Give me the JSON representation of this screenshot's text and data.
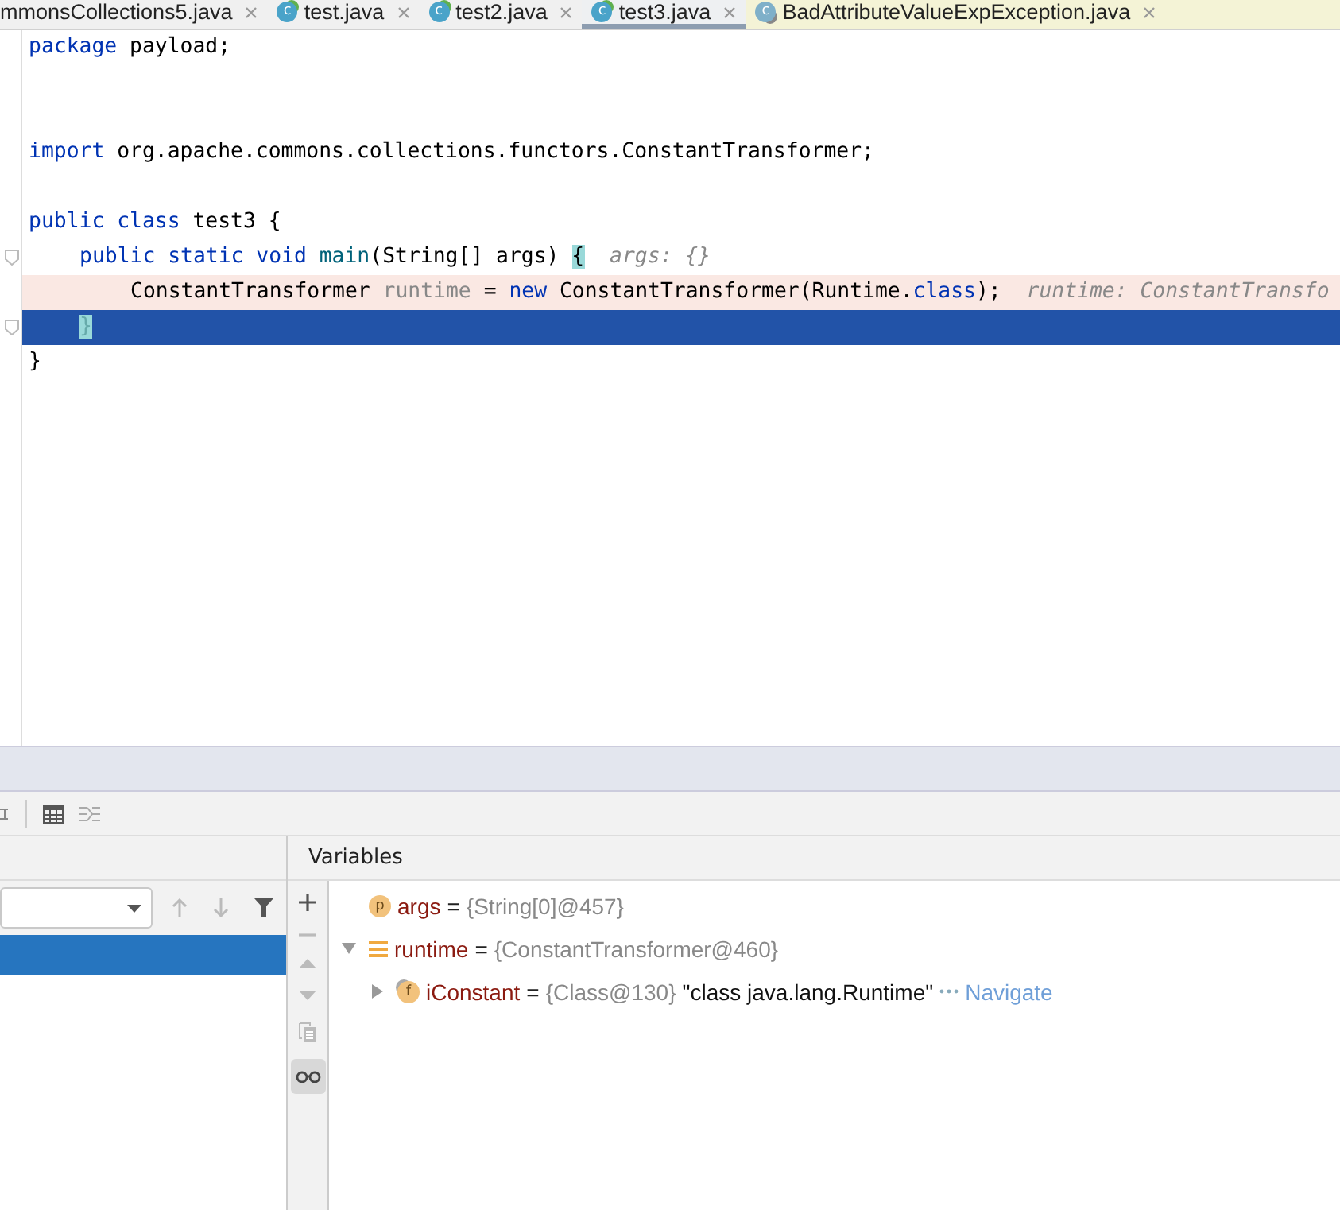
{
  "tabs": [
    {
      "label": "mmonsCollections5.java",
      "kind": "partial",
      "selected": false
    },
    {
      "label": "test.java",
      "kind": "class",
      "badge": "c",
      "selected": false
    },
    {
      "label": "test2.java",
      "kind": "class",
      "badge": "c",
      "selected": false
    },
    {
      "label": "test3.java",
      "kind": "class",
      "badge": "c",
      "selected": true
    },
    {
      "label": "BadAttributeValueExpException.java",
      "kind": "library",
      "badge": "c",
      "selected": false
    }
  ],
  "editor": {
    "lines": [
      {
        "breakpoint": false,
        "current": false,
        "fold": false,
        "tokens": [
          {
            "kind": "keyword",
            "text": "package"
          },
          {
            "kind": "plain",
            "text": " payload;"
          }
        ]
      },
      {
        "breakpoint": false,
        "current": false,
        "fold": false
      },
      {
        "breakpoint": false,
        "current": false,
        "fold": false
      },
      {
        "breakpoint": false,
        "current": false,
        "fold": false,
        "tokens": [
          {
            "kind": "keyword",
            "text": "import"
          },
          {
            "kind": "plain",
            "text": " org.apache.commons.collections.functors.ConstantTransformer;"
          }
        ]
      },
      {
        "breakpoint": false,
        "current": false,
        "fold": false
      },
      {
        "breakpoint": false,
        "current": false,
        "fold": false,
        "tokens": [
          {
            "kind": "keyword",
            "text": "public class"
          },
          {
            "kind": "plain",
            "text": " test3 {"
          }
        ]
      },
      {
        "breakpoint": false,
        "current": false,
        "fold": true,
        "tokens": [
          {
            "kind": "keyword",
            "text": "    public static void"
          },
          {
            "kind": "method",
            "text": " main"
          },
          {
            "kind": "plain",
            "text": "(String[] args) "
          },
          {
            "kind": "brace",
            "text": "{"
          },
          {
            "kind": "hint",
            "text": "  args: {}"
          }
        ]
      },
      {
        "breakpoint": true,
        "current": false,
        "fold": false,
        "tokens": [
          {
            "kind": "plain",
            "text": "        ConstantTransformer "
          },
          {
            "kind": "local",
            "text": "runtime"
          },
          {
            "kind": "plain",
            "text": " = "
          },
          {
            "kind": "keyword",
            "text": "new"
          },
          {
            "kind": "plain",
            "text": " ConstantTransformer(Runtime."
          },
          {
            "kind": "keyword",
            "text": "class"
          },
          {
            "kind": "plain",
            "text": ");"
          },
          {
            "kind": "hint",
            "text": "  runtime: ConstantTransfo"
          }
        ]
      },
      {
        "breakpoint": false,
        "current": true,
        "fold": true,
        "tokens": [
          {
            "kind": "brace",
            "text": "    }"
          }
        ]
      },
      {
        "breakpoint": false,
        "current": false,
        "fold": false,
        "tokens": [
          {
            "kind": "plain",
            "text": "}"
          }
        ]
      }
    ]
  },
  "frames": {
    "rows": [
      {
        "selected": true
      }
    ]
  },
  "variables": {
    "title": "Variables",
    "items": [
      {
        "kind": "parameter",
        "badge": "p",
        "name": "args",
        "separator": "=",
        "value": "{String[0]@457}"
      },
      {
        "kind": "object",
        "name": "runtime",
        "separator": "=",
        "value": "{ConstantTransformer@460}",
        "expanded": true,
        "children": [
          {
            "kind": "field",
            "badge": "f",
            "name": "iConstant",
            "separator": "=",
            "value": "{Class@130}",
            "string": "\"class java.lang.Runtime\"",
            "link": "Navigate",
            "expanded": false
          }
        ]
      }
    ]
  }
}
